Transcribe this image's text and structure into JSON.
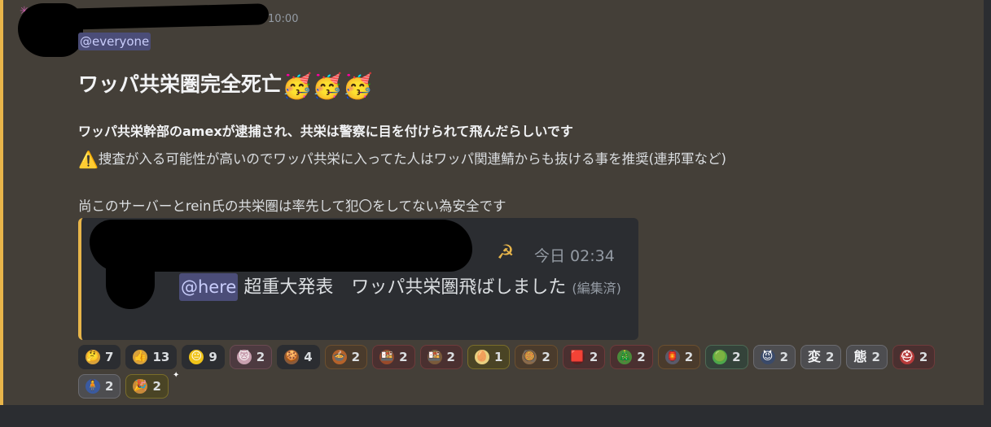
{
  "message": {
    "timestamp": "10:00",
    "mention": "@everyone",
    "headline": "ワッパ共栄圏完全死亡",
    "headline_emoji": "🥳🥳🥳",
    "bold_line": "ワッパ共栄幹部のamexが逮捕され、共栄は警察に目を付けられて飛んだらしいです",
    "warning_icon": "⚠️",
    "warning_line": "捜査が入る可能性が高いのでワッパ共栄に入ってた人はワッパ関連鯖からも抜ける事を推奨(連邦軍など)",
    "note_line": "尚このサーバーとrein氏の共栄圏は率先して犯〇をしてない為安全です"
  },
  "embed": {
    "icon": "☭",
    "time": "今日 02:34",
    "mention": "@here",
    "body": " 超重大発表　ワッパ共栄圏飛ばしました",
    "edited": "(編集済)"
  },
  "reactions": [
    {
      "emoji": "🤔",
      "count": "7",
      "style": "plain",
      "color": "#d9a23a"
    },
    {
      "emoji": "👍",
      "count": "13",
      "style": "plain",
      "color": "#d9a23a"
    },
    {
      "emoji": "😐",
      "count": "9",
      "style": "plain",
      "color": "#f0c419"
    },
    {
      "emoji": "🐱",
      "count": "2",
      "style": "pink",
      "color": "#c9a0b0"
    },
    {
      "emoji": "🍪",
      "count": "4",
      "style": "plain",
      "color": "#8a5a3a"
    },
    {
      "emoji": "🍲",
      "count": "2",
      "style": "brown",
      "color": "#b5622a"
    },
    {
      "emoji": "🍱",
      "count": "2",
      "style": "red",
      "color": "#9a4a2a"
    },
    {
      "emoji": "🍱",
      "count": "2",
      "style": "red",
      "color": "#7a5a3a"
    },
    {
      "emoji": "🥚",
      "count": "1",
      "style": "gold",
      "color": "#e8d080"
    },
    {
      "emoji": "🥘",
      "count": "2",
      "style": "brown",
      "color": "#8a6a4a"
    },
    {
      "emoji": "🟥",
      "count": "2",
      "style": "red",
      "color": "#5a2020"
    },
    {
      "emoji": "🎄",
      "count": "2",
      "style": "red",
      "color": "#4a8a3a"
    },
    {
      "emoji": "🏮",
      "count": "2",
      "style": "brown",
      "color": "#5a5a6a"
    },
    {
      "emoji": "🟢",
      "count": "2",
      "style": "green",
      "color": "#4ca84c"
    },
    {
      "emoji": "😈",
      "count": "2",
      "style": "grey",
      "color": "#3a4a6a"
    },
    {
      "emoji": "変",
      "count": "2",
      "style": "grey kanji",
      "color": "#f2f3f5"
    },
    {
      "emoji": "態",
      "count": "2",
      "style": "grey kanji",
      "color": "#f2f3f5"
    },
    {
      "emoji": "⛑",
      "count": "2",
      "style": "red",
      "color": "#b83a3a"
    },
    {
      "emoji": "🧍",
      "count": "2",
      "style": "grey",
      "color": "#3a5aa0"
    },
    {
      "emoji": "🎉",
      "count": "2",
      "style": "gold",
      "color": "#c88a3a"
    }
  ]
}
